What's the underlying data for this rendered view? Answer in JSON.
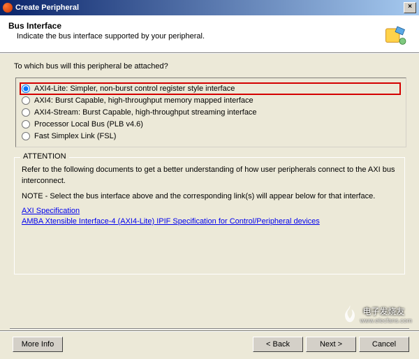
{
  "window": {
    "title": "Create Peripheral"
  },
  "header": {
    "title": "Bus Interface",
    "description": "Indicate the bus interface supported by your peripheral."
  },
  "question": "To which bus will this peripheral be attached?",
  "bus_options": [
    {
      "label": "AXI4-Lite: Simpler, non-burst control register style interface",
      "selected": true,
      "highlighted": true
    },
    {
      "label": "AXI4: Burst Capable, high-throughput memory mapped interface",
      "selected": false,
      "highlighted": false
    },
    {
      "label": "AXI4-Stream: Burst Capable, high-throughput streaming interface",
      "selected": false,
      "highlighted": false
    },
    {
      "label": "Processor Local Bus (PLB v4.6)",
      "selected": false,
      "highlighted": false
    },
    {
      "label": "Fast Simplex Link (FSL)",
      "selected": false,
      "highlighted": false
    }
  ],
  "attention": {
    "legend": "ATTENTION",
    "para1": "Refer to the following documents to get a better understanding of how user peripherals connect to the AXI bus interconnect.",
    "para2": "NOTE - Select the bus interface above and the corresponding link(s) will appear below for that interface.",
    "links": [
      "AXI Specification",
      "AMBA Xtensible Interface-4 (AXI4-Lite) IPIF Specification for Control/Peripheral devices"
    ]
  },
  "buttons": {
    "more_info": "More Info",
    "back": "< Back",
    "next": "Next >",
    "cancel": "Cancel"
  },
  "watermark": {
    "brand": "电子发烧友",
    "url": "www.elecfans.com"
  }
}
